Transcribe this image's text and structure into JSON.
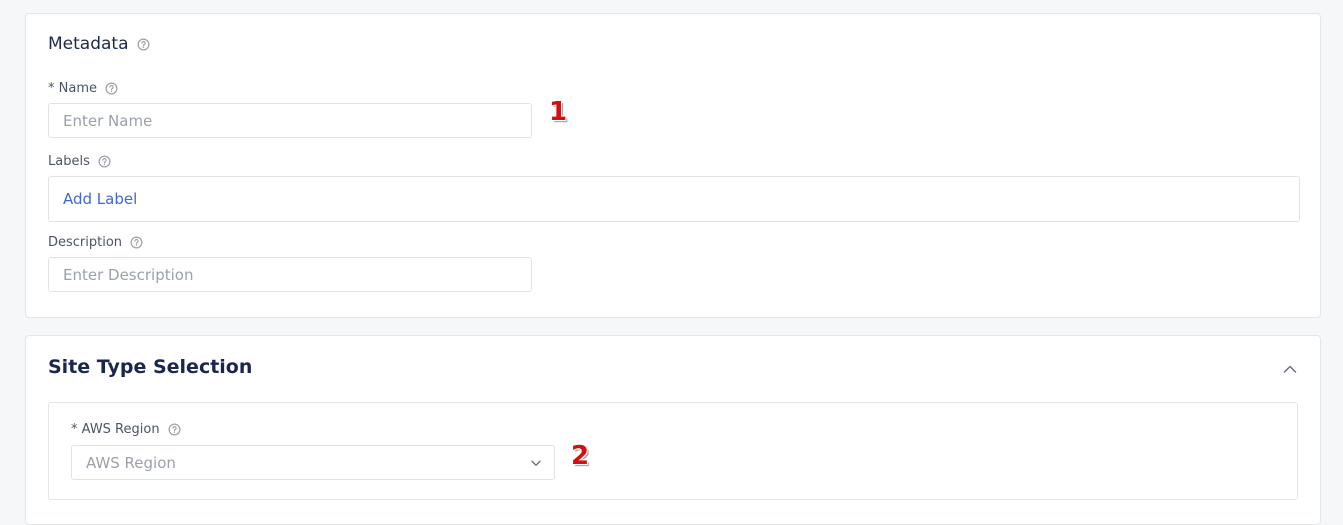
{
  "metadata": {
    "title": "Metadata",
    "name_label": "* Name",
    "name_placeholder": "Enter Name",
    "labels_label": "Labels",
    "add_label": "Add Label",
    "description_label": "Description",
    "description_placeholder": "Enter Description"
  },
  "site_type": {
    "title": "Site Type Selection",
    "region_label": "* AWS Region",
    "region_placeholder": "AWS Region"
  },
  "markers": {
    "m1": "1",
    "m2": "2"
  },
  "icons": {
    "help": "help-circle-icon",
    "collapse": "chevron-up-icon",
    "dropdown": "chevron-down-icon"
  },
  "colors": {
    "link": "#3f67d6",
    "title": "#1a2550",
    "marker": "#d40f12"
  }
}
